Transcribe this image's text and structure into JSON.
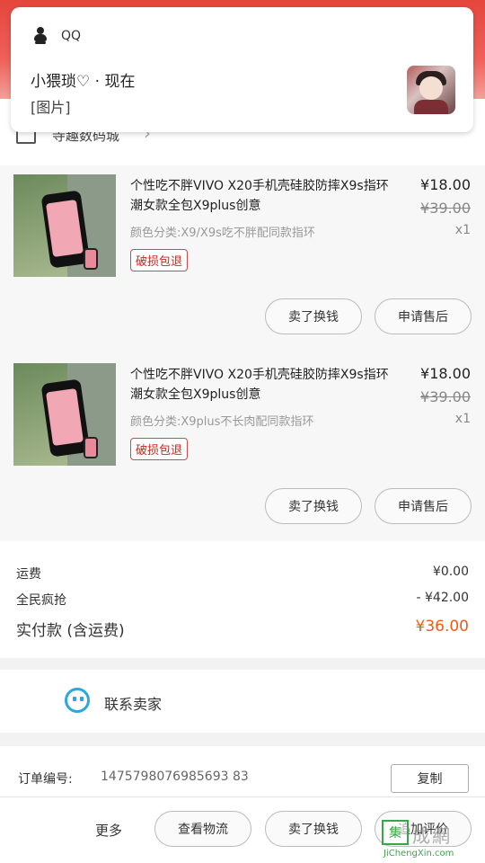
{
  "notification": {
    "app_name": "QQ",
    "sender": "小猥琐♡ · 现在",
    "message": "[图片]"
  },
  "shop": {
    "name": "寺趣数码城"
  },
  "items": [
    {
      "title": "个性吃不胖VIVO X20手机壳硅胶防摔X9s指环潮女款全包X9plus创意",
      "variant": "颜色分类:X9/X9s吃不胖配同款指环",
      "tag": "破损包退",
      "price": "¥18.00",
      "original_price": "¥39.00",
      "quantity": "x1",
      "actions": [
        "卖了换钱",
        "申请售后"
      ]
    },
    {
      "title": "个性吃不胖VIVO X20手机壳硅胶防摔X9s指环潮女款全包X9plus创意",
      "variant": "颜色分类:X9plus不长肉配同款指环",
      "tag": "破损包退",
      "price": "¥18.00",
      "original_price": "¥39.00",
      "quantity": "x1",
      "actions": [
        "卖了换钱",
        "申请售后"
      ]
    }
  ],
  "summary": {
    "shipping_label": "运费",
    "shipping_value": "¥0.00",
    "discount_label": "全民疯抢",
    "discount_value": "- ¥42.00",
    "total_label": "实付款 (含运费)",
    "total_value": "¥36.00"
  },
  "contact": {
    "label": "联系卖家"
  },
  "order": {
    "number_label": "订单编号:",
    "number": "1475798076985693 83",
    "copy_label": "复制"
  },
  "bottom_bar": {
    "more": "更多",
    "buttons": [
      "查看物流",
      "卖了换钱",
      "追加评价"
    ]
  },
  "watermark": {
    "mark": "集",
    "text": "成網",
    "url": "JiChengXin.com"
  },
  "colors": {
    "brand_red": "#e4463b",
    "price_orange": "#f05a14",
    "chat_blue": "#2ba6e0",
    "tag_red": "#c8261c"
  }
}
